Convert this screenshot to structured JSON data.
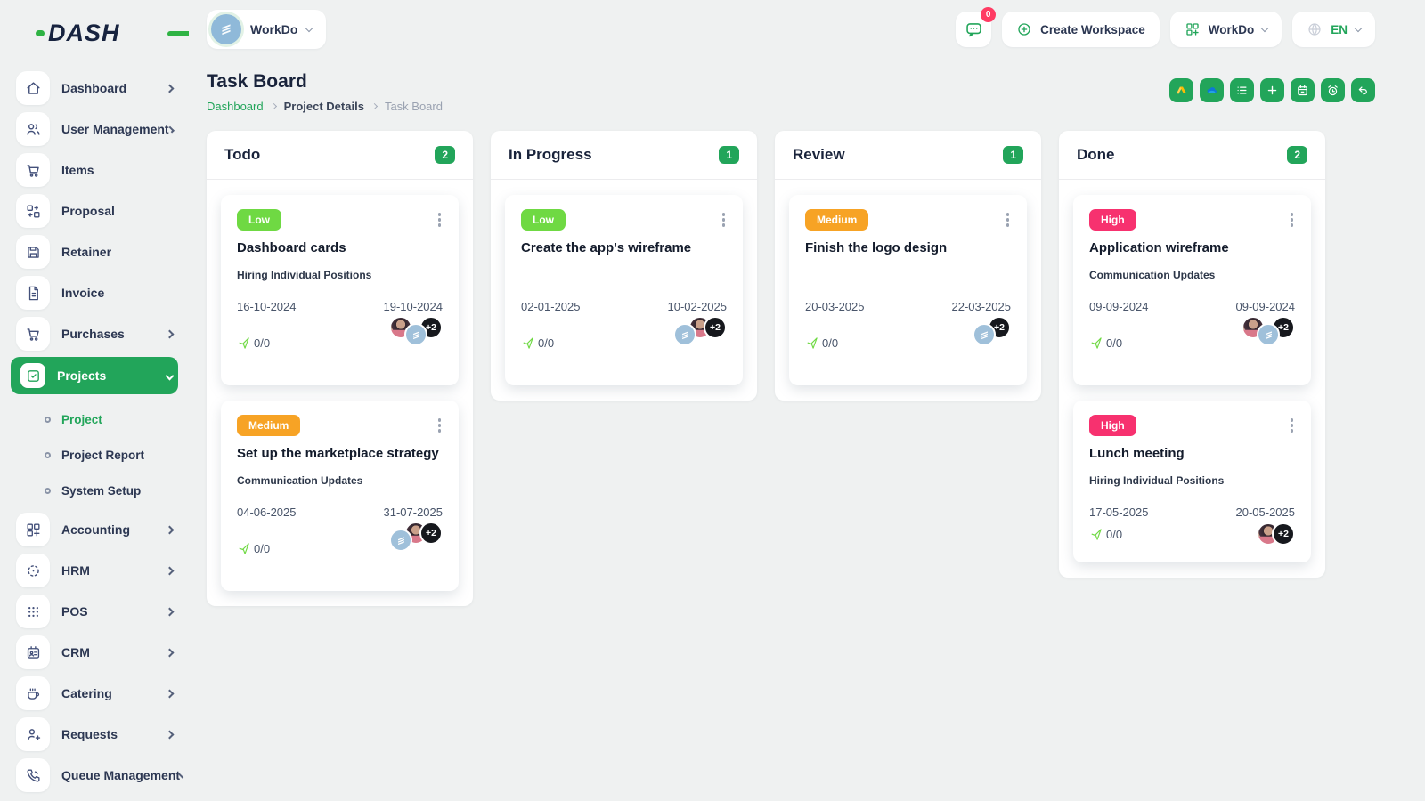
{
  "brand": {
    "name": "DASH"
  },
  "topbar": {
    "workspace_selector": {
      "label": "WorkDo",
      "icon": "workdo-building-logo"
    },
    "messages": {
      "badge": "0",
      "icon": "chat-bubble-icon"
    },
    "create_workspace": {
      "label": "Create Workspace",
      "icon": "plus-circle-icon"
    },
    "workdo_menu": {
      "label": "WorkDo",
      "icon": "grid-plus-icon"
    },
    "language": {
      "code": "EN",
      "icon": "globe-icon"
    }
  },
  "sidebar": {
    "items": [
      {
        "label": "Dashboard",
        "icon": "home-icon",
        "expandable": true
      },
      {
        "label": "User Management",
        "icon": "users-icon",
        "expandable": true
      },
      {
        "label": "Items",
        "icon": "cart-icon",
        "expandable": false
      },
      {
        "label": "Proposal",
        "icon": "transfer-icon",
        "expandable": false
      },
      {
        "label": "Retainer",
        "icon": "floppy-icon",
        "expandable": false
      },
      {
        "label": "Invoice",
        "icon": "file-invoice-icon",
        "expandable": false
      },
      {
        "label": "Purchases",
        "icon": "cart-icon",
        "expandable": true
      },
      {
        "label": "Projects",
        "icon": "checkbox-icon",
        "expandable": true,
        "active": true,
        "expanded": true
      },
      {
        "label": "Accounting",
        "icon": "grid-plus-icon",
        "expandable": true
      },
      {
        "label": "HRM",
        "icon": "dotted-circle-icon",
        "expandable": true
      },
      {
        "label": "POS",
        "icon": "dots-grid-icon",
        "expandable": true
      },
      {
        "label": "CRM",
        "icon": "id-card-icon",
        "expandable": true
      },
      {
        "label": "Catering",
        "icon": "coffee-icon",
        "expandable": true
      },
      {
        "label": "Requests",
        "icon": "user-plus-icon",
        "expandable": true
      },
      {
        "label": "Queue Management",
        "icon": "phone-icon",
        "expandable": true
      }
    ],
    "projects_submenu": [
      {
        "label": "Project",
        "active": true
      },
      {
        "label": "Project Report",
        "active": false
      },
      {
        "label": "System Setup",
        "active": false
      }
    ]
  },
  "page": {
    "title": "Task Board",
    "breadcrumb": {
      "home": "Dashboard",
      "section": "Project Details",
      "current": "Task Board"
    }
  },
  "toolbar": {
    "buttons": [
      "google-drive-icon",
      "onedrive-icon",
      "list-icon",
      "add-icon",
      "calendar-icon",
      "timer-icon",
      "back-icon"
    ]
  },
  "board": {
    "columns": [
      {
        "title": "Todo",
        "count": "2",
        "cards": [
          {
            "priority": "Low",
            "priority_level": "low",
            "title": "Dashboard cards",
            "milestone": "Hiring Individual Positions",
            "start_date": "16-10-2024",
            "end_date": "19-10-2024",
            "messages": "0/0",
            "more": "+2",
            "avatars": [
              "user-photo",
              "workdo-logo"
            ]
          },
          {
            "priority": "Medium",
            "priority_level": "medium",
            "title": "Set up the marketplace strategy",
            "milestone": "Communication Updates",
            "start_date": "04-06-2025",
            "end_date": "31-07-2025",
            "messages": "0/0",
            "more": "+2",
            "avatars": [
              "workdo-logo",
              "user-photo"
            ]
          }
        ]
      },
      {
        "title": "In Progress",
        "count": "1",
        "cards": [
          {
            "priority": "Low",
            "priority_level": "low",
            "title": "Create the app's wireframe",
            "milestone": "",
            "start_date": "02-01-2025",
            "end_date": "10-02-2025",
            "messages": "0/0",
            "more": "+2",
            "avatars": [
              "workdo-logo",
              "user-photo"
            ]
          }
        ]
      },
      {
        "title": "Review",
        "count": "1",
        "cards": [
          {
            "priority": "Medium",
            "priority_level": "medium",
            "title": "Finish the logo design",
            "milestone": "",
            "start_date": "20-03-2025",
            "end_date": "22-03-2025",
            "messages": "0/0",
            "more": "+2",
            "avatars": [
              "workdo-logo"
            ]
          }
        ]
      },
      {
        "title": "Done",
        "count": "2",
        "cards": [
          {
            "priority": "High",
            "priority_level": "high",
            "title": "Application wireframe",
            "milestone": "Communication Updates",
            "start_date": "09-09-2024",
            "end_date": "09-09-2024",
            "messages": "0/0",
            "more": "+2",
            "avatars": [
              "user-photo",
              "workdo-logo"
            ]
          },
          {
            "priority": "High",
            "priority_level": "high",
            "title": "Lunch meeting",
            "milestone": "Hiring Individual Positions",
            "start_date": "17-05-2025",
            "end_date": "20-05-2025",
            "messages": "0/0",
            "more": "+2",
            "avatars": [
              "user-photo"
            ]
          }
        ]
      }
    ]
  },
  "colors": {
    "primary_green": "#22a55a",
    "lime_green": "#6fd943",
    "priority_low": "#6fd943",
    "priority_medium": "#f7a325",
    "priority_high": "#f7316f",
    "notification_red": "#ff3b63",
    "navy_text": "#19233b",
    "drive_yellow": "#fbbc04",
    "onedrive_blue": "#0e78d5",
    "background": "#eff1f1"
  }
}
